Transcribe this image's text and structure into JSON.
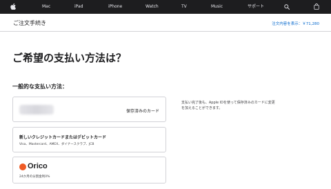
{
  "global_nav": {
    "apple_icon": "apple-logo-icon",
    "items": [
      "Mac",
      "iPad",
      "iPhone",
      "Watch",
      "TV",
      "Music",
      "サポート"
    ],
    "search_icon": "search-icon",
    "bag_icon": "bag-icon"
  },
  "subnav": {
    "title": "ご注文手続き",
    "summary_link": "注文内容を表示：￥71,280"
  },
  "page": {
    "heading": "ご希望の支払い方法は？",
    "subheading": "一般的な支払い方法："
  },
  "payment_options": {
    "saved": {
      "label": "保存済みのカード"
    },
    "new_card": {
      "title": "新しいクレジットカードまたはデビットカード",
      "brands": "Visa、Mastercard、AMEX、ダイナースクラブ、JCB"
    },
    "orico": {
      "logo_text": "Orico",
      "note": "24か月の分割金利0%"
    }
  },
  "side_note": "支払い完了後も、Apple IDを使って保存済みのカードに変更を加えることができます。",
  "colors": {
    "nav_bg": "#1d1d1f",
    "link": "#0066cc",
    "orico_brand": "#ef5b25"
  }
}
